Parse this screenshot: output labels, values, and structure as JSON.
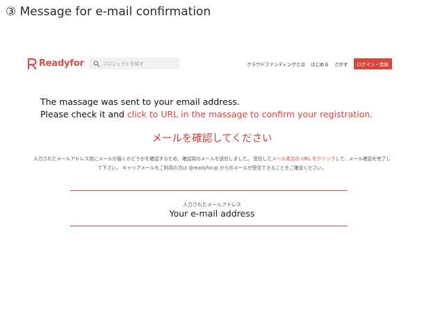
{
  "slide_title": "③ Message for e-mail confirmation",
  "header": {
    "logo_text": "Readyfor",
    "search_placeholder": "プロジェクトを探す",
    "nav": [
      "クラウドファンディングとは",
      "はじめる",
      "さがす"
    ],
    "login_label": "ログイン・登録"
  },
  "message": {
    "line1": "The massage was sent to your email address.",
    "line2_plain": "Please check it and",
    "line2_link": "click to URL in the massage to confirm your registration."
  },
  "confirm": {
    "heading": "メールを確認してください",
    "info_part1": "入力されたメールアドレス宛にメールが届くかどうかを確認するため、確認用のメールを送信しました。 受信した",
    "info_red": "メール本文の URL をクリック",
    "info_part2": "して、メール確認を完了して下さい。 キャリアメールをご利用の方は @readyfor.jp からのメールが受信できることをご確認ください。",
    "field_label": "入力されたメールアドレス",
    "field_value": "Your e-mail address"
  },
  "colors": {
    "brand_red": "#d9463d"
  }
}
